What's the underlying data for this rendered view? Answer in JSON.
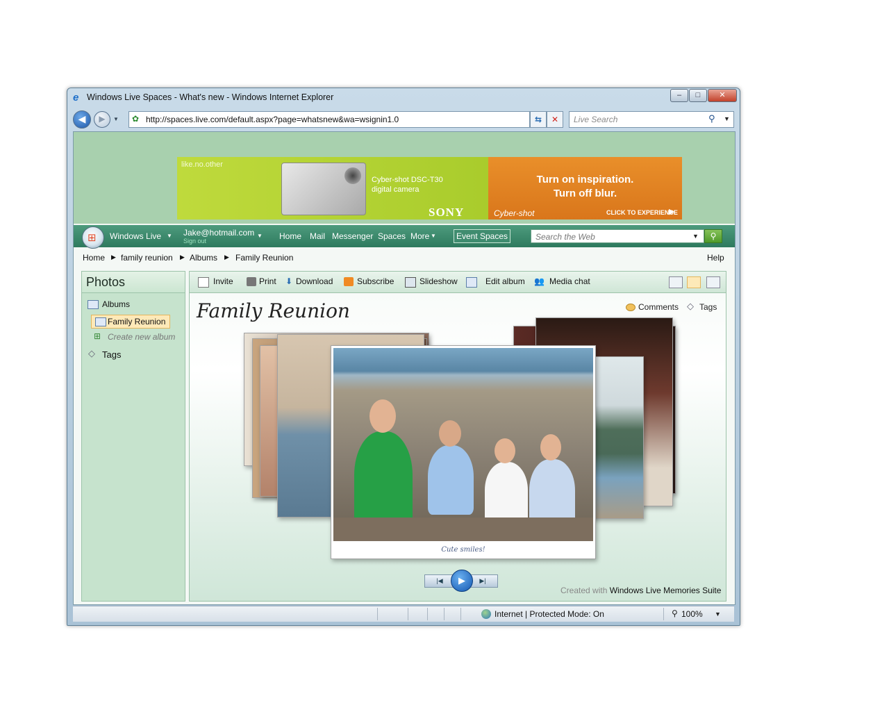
{
  "window": {
    "title": "Windows Live Spaces - What's new - Windows Internet Explorer"
  },
  "browser": {
    "url": "http://spaces.live.com/default.aspx?page=whatsnew&wa=wsignin1.0",
    "search_placeholder": "Live Search"
  },
  "ad": {
    "tagline": "like.no.other",
    "model_line1": "Cyber-shot DSC-T30",
    "model_line2": "digital camera",
    "brand": "SONY",
    "headline1": "Turn on inspiration.",
    "headline2": "Turn off blur.",
    "product": "Cyber-shot",
    "cta": "CLICK TO EXPERIENCE"
  },
  "livenav": {
    "brand": "Windows Live",
    "account": "Jake@hotmail.com",
    "signout": "Sign out",
    "links": [
      "Home",
      "Mail",
      "Messenger",
      "Spaces",
      "More"
    ],
    "event_spaces": "Event Spaces",
    "search_placeholder": "Search the Web"
  },
  "breadcrumb": [
    "Home",
    "family reunion",
    "Albums",
    "Family Reunion"
  ],
  "help": "Help",
  "sidebar": {
    "title": "Photos",
    "albums": "Albums",
    "selected_album": "Family Reunion",
    "create": "Create new album",
    "tags": "Tags"
  },
  "toolbar": {
    "invite": "Invite",
    "print": "Print",
    "download": "Download",
    "subscribe": "Subscribe",
    "slideshow": "Slideshow",
    "edit_album": "Edit album",
    "media_chat": "Media chat"
  },
  "album": {
    "title": "Family Reunion",
    "comments": "Comments",
    "tags": "Tags",
    "caption": "Cute smiles!"
  },
  "credit": {
    "prefix": "Created with",
    "product": "Windows Live Memories Suite"
  },
  "status": {
    "zone": "Internet | Protected Mode: On",
    "zoom": "100%"
  },
  "colors": {
    "accent_green": "#2e7a5e",
    "banner_bg": "#a8d0ae",
    "ad_orange": "#e98f2a",
    "ad_lime": "#bfda3c"
  }
}
